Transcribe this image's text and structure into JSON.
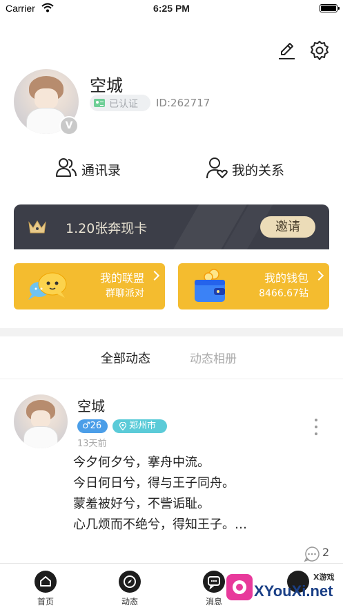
{
  "status_bar": {
    "carrier": "Carrier",
    "time": "6:25 PM"
  },
  "profile": {
    "name": "空城",
    "verified_label": "已认证",
    "id_text": "ID:262717",
    "vip_badge": "V"
  },
  "quick_links": {
    "contacts": "通讯录",
    "relations": "我的关系"
  },
  "card_banner": {
    "text": "1.20张奔现卡",
    "invite": "邀请"
  },
  "tiles": {
    "alliance": {
      "title": "我的联盟",
      "subtitle": "群聊派对"
    },
    "wallet": {
      "title": "我的钱包",
      "subtitle": "8466.67钻"
    }
  },
  "feed_tabs": {
    "all": "全部动态",
    "album": "动态相册"
  },
  "post": {
    "author": "空城",
    "gender_age": "♂26",
    "location": "郑州市",
    "time": "13天前",
    "lines": [
      "今夕何夕兮，搴舟中流。",
      "今日何日兮，得与王子同舟。",
      "蒙羞被好兮，不訾诟耻。",
      "心几烦而不绝兮，得知王子。…"
    ],
    "comment_count": "2"
  },
  "tabbar": {
    "home": "首页",
    "feed": "动态",
    "messages": "消息"
  },
  "watermark": {
    "cn": "X游戏",
    "brand": "XYouXi.net"
  },
  "colors": {
    "accent_yellow": "#f4bc2f",
    "card_dark": "#3c3e48",
    "gender_blue": "#4b9ee8",
    "location_teal": "#5bcbd8"
  }
}
